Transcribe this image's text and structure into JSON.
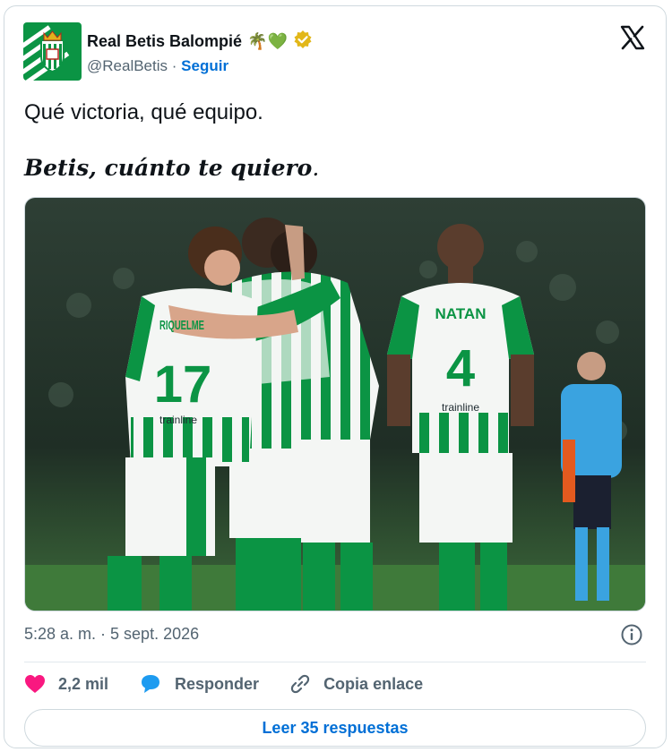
{
  "post": {
    "author_name": "Real Betis Balompié",
    "author_emojis": "🌴💚",
    "handle": "@RealBetis",
    "separator": "·",
    "follow_label": "Seguir",
    "text_line1": "Qué victoria, qué equipo.",
    "text_line2_bold": "Betis",
    "text_line2_rest": ", cuánto te quiero",
    "text_line2_end": ".",
    "timestamp": "5:28 a. m. · 5 sept. 2026"
  },
  "photo": {
    "player_left_name": "RIQUELME",
    "player_left_number": "17",
    "player_right_name": "NATAN",
    "player_right_number": "4",
    "sponsor": "trainline",
    "colors": {
      "green": "#0b9444",
      "white": "#f4f6f4",
      "stadium": "#22342a"
    }
  },
  "actions": {
    "likes_count": "2,2 mil",
    "reply_label": "Responder",
    "copy_label": "Copia enlace"
  },
  "footer": {
    "read_replies_label": "Leer 35 respuestas"
  },
  "colors": {
    "accent": "#006fd6",
    "like": "#f91880",
    "reply": "#1d9bf0",
    "verified": "#e2b719"
  },
  "icons": [
    "x-logo-icon",
    "verified-badge-icon",
    "info-icon",
    "heart-icon",
    "reply-icon",
    "link-icon"
  ]
}
